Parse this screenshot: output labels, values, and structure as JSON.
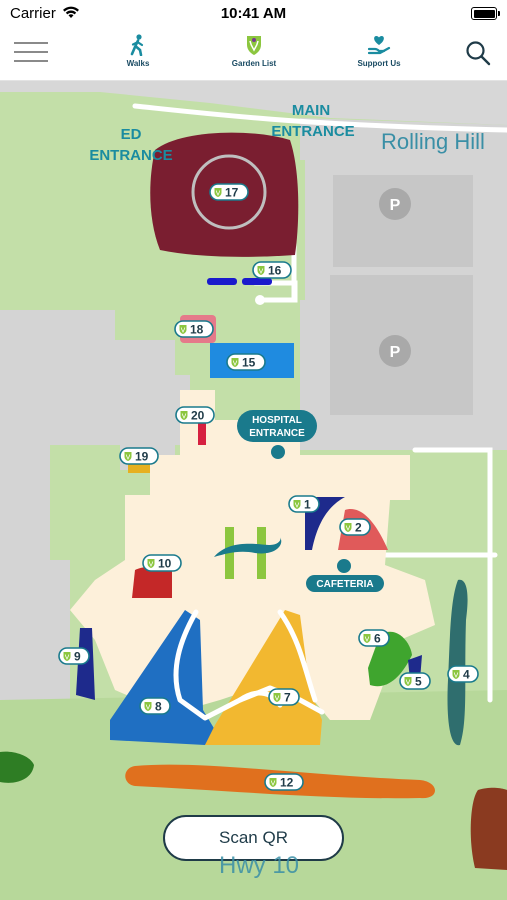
{
  "status_bar": {
    "carrier": "Carrier",
    "time": "10:41 AM"
  },
  "nav": {
    "walks_label": "Walks",
    "garden_list_label": "Garden List",
    "support_label": "Support Us"
  },
  "map": {
    "road_labels": {
      "rolling_hill": "Rolling Hill",
      "hwy": "Hwy 10"
    },
    "entrances": {
      "main_line1": "MAIN",
      "main_line2": "ENTRANCE",
      "ed_line1": "ED",
      "ed_line2": "ENTRANCE",
      "hospital_line1": "HOSPITAL",
      "hospital_line2": "ENTRANCE",
      "cafeteria": "CAFETERIA"
    },
    "parking_symbol": "P",
    "gardens": [
      {
        "number": "1",
        "color": "#1e2a8c"
      },
      {
        "number": "2",
        "color": "#e05a5a"
      },
      {
        "number": "4",
        "color": "#2f6e6e"
      },
      {
        "number": "5",
        "color": "#1e2a8c"
      },
      {
        "number": "6",
        "color": "#3fa52e"
      },
      {
        "number": "7",
        "color": "#f2b830"
      },
      {
        "number": "8",
        "color": "#1f6fc2"
      },
      {
        "number": "9",
        "color": "#1e2a8c"
      },
      {
        "number": "10",
        "color": "#c42828"
      },
      {
        "number": "12",
        "color": "#e0701e"
      },
      {
        "number": "15",
        "color": "#1f8be0"
      },
      {
        "number": "16",
        "color": "#1a1acc"
      },
      {
        "number": "17",
        "color": "#7a1e30"
      },
      {
        "number": "18",
        "color": "#e57a8a"
      },
      {
        "number": "19",
        "color": "#e6b020"
      },
      {
        "number": "20",
        "color": "#d62040"
      }
    ]
  },
  "scan_qr_label": "Scan QR",
  "colors": {
    "grass": "#c3dfa8",
    "road": "#d4d4d4",
    "building": "#fdf0da",
    "teal": "#1a7a8c",
    "brand_green": "#8cc63f"
  }
}
